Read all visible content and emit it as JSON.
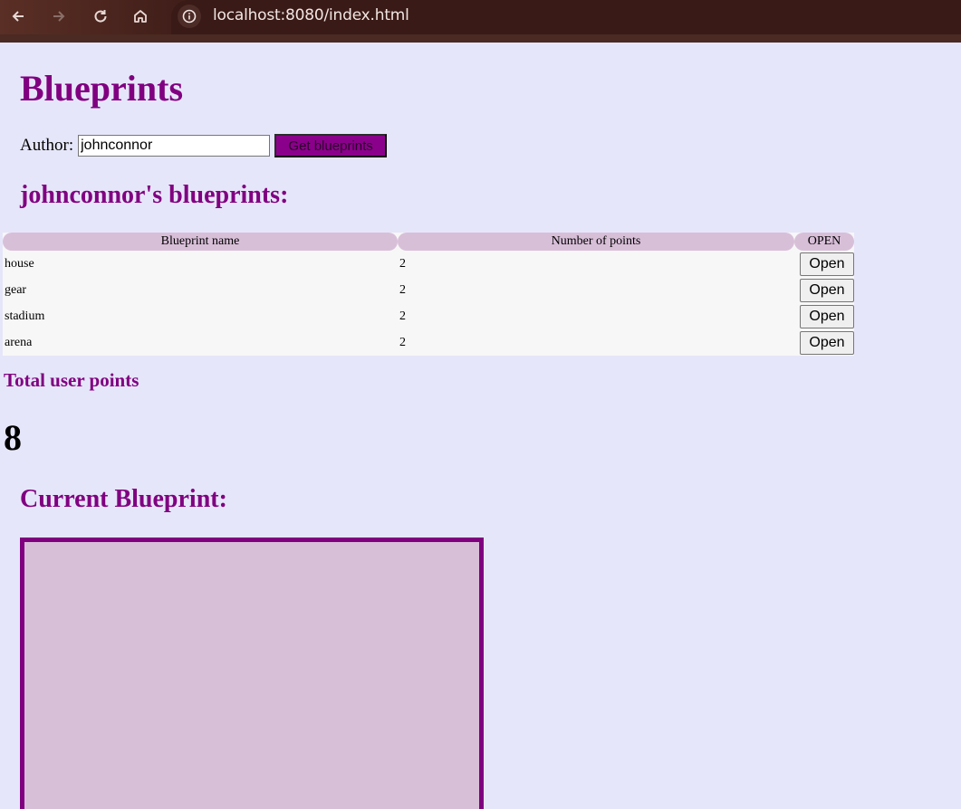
{
  "browser": {
    "url": "localhost:8080/index.html",
    "icons": [
      "back-icon",
      "forward-icon",
      "reload-icon",
      "home-icon",
      "info-icon"
    ]
  },
  "page": {
    "title": "Blueprints",
    "author_label": "Author:",
    "author_value": "johnconnor",
    "get_button_label": "Get blueprints",
    "blueprints_heading": "johnconnor's blueprints:",
    "table": {
      "headers": [
        "Blueprint name",
        "Number of points",
        "OPEN"
      ],
      "rows": [
        {
          "name": "house",
          "points": "2",
          "action": "Open"
        },
        {
          "name": "gear",
          "points": "2",
          "action": "Open"
        },
        {
          "name": "stadium",
          "points": "2",
          "action": "Open"
        },
        {
          "name": "arena",
          "points": "2",
          "action": "Open"
        }
      ]
    },
    "total_label": "Total user points",
    "total_value": "8",
    "current_heading": "Current Blueprint:"
  },
  "colors": {
    "background": "#e6e6fa",
    "accent": "#800080",
    "header_fill": "#d8bfd8",
    "button_fill": "#8b008b",
    "canvas_fill": "#d8bfd8"
  }
}
